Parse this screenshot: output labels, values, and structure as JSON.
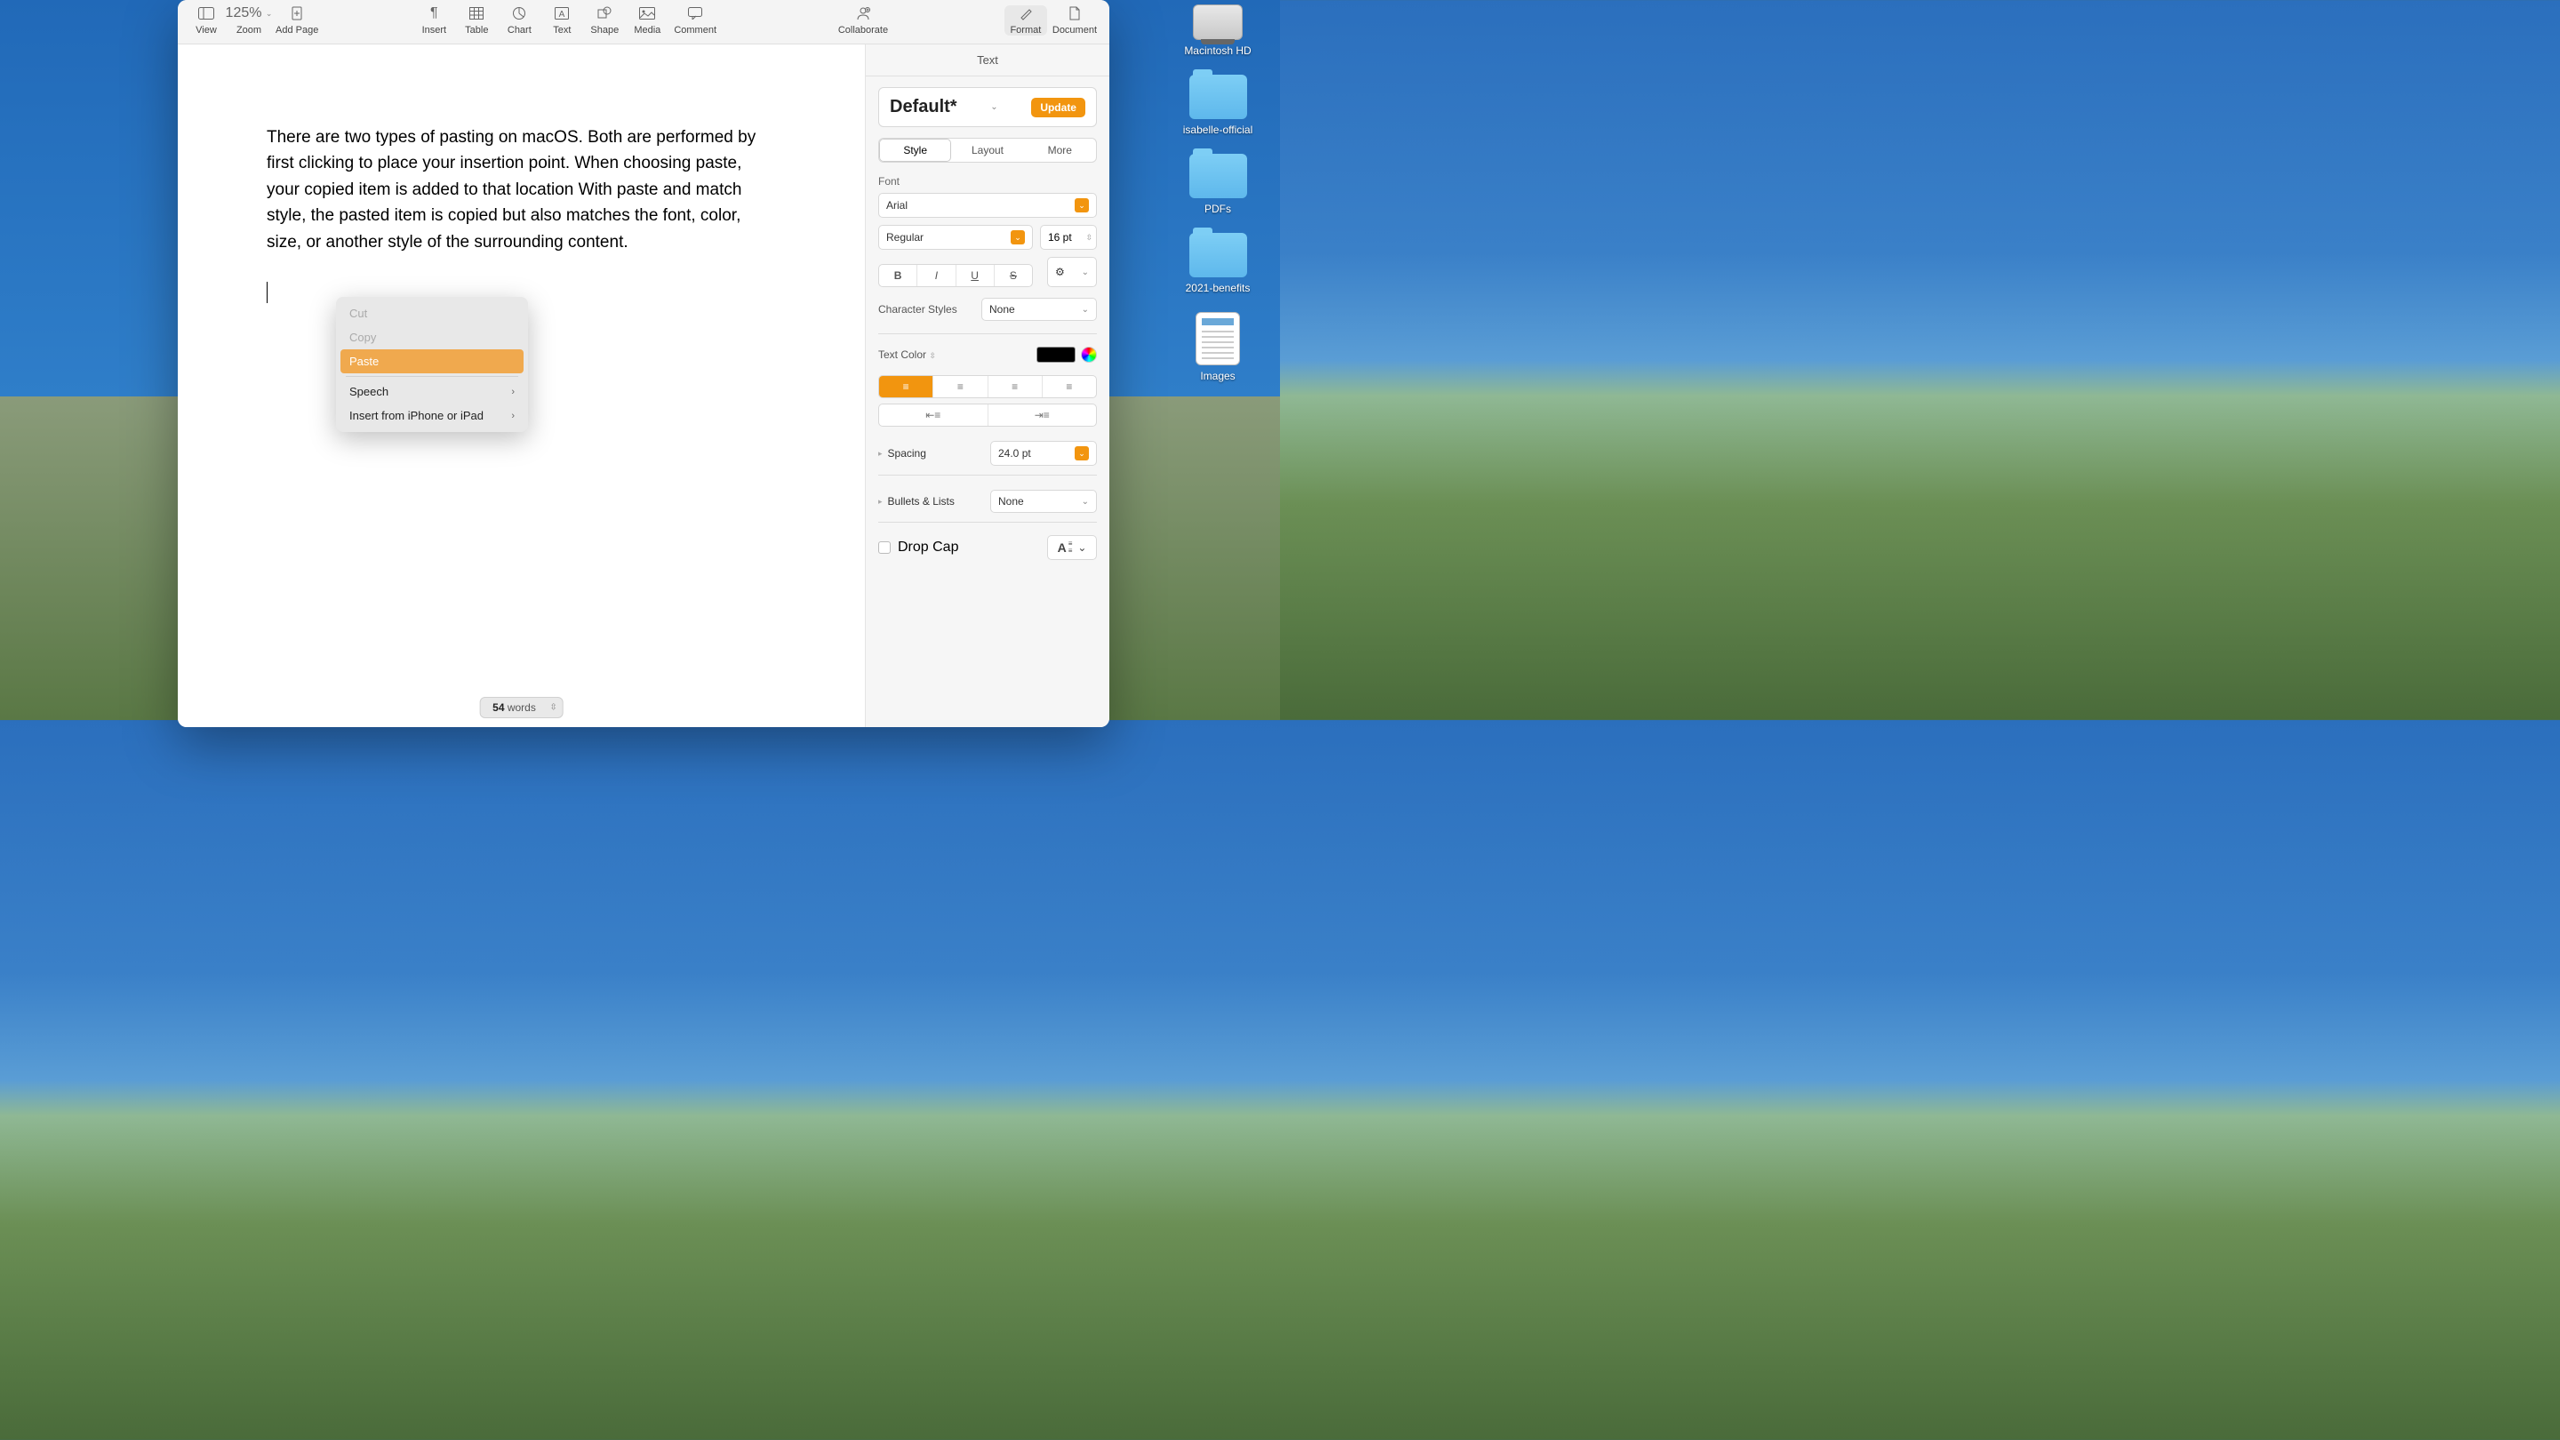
{
  "desktop": {
    "icons": [
      {
        "type": "hd",
        "label": "Macintosh HD"
      },
      {
        "type": "folder",
        "label": "isabelle-official"
      },
      {
        "type": "folder",
        "label": "PDFs"
      },
      {
        "type": "folder",
        "label": "2021-benefits"
      },
      {
        "type": "img",
        "label": "Images"
      }
    ]
  },
  "toolbar": {
    "view": "View",
    "zoom_label": "Zoom",
    "zoom_value": "125%",
    "add_page": "Add Page",
    "insert": "Insert",
    "table": "Table",
    "chart": "Chart",
    "text": "Text",
    "shape": "Shape",
    "media": "Media",
    "comment": "Comment",
    "collaborate": "Collaborate",
    "format": "Format",
    "document": "Document"
  },
  "document": {
    "body": "There are two types of pasting on macOS. Both are performed by first clicking to place your insertion point. When choosing paste, your copied item is added to that location With paste and match style, the pasted item is copied but also matches the font, color, size, or another style of the surrounding content.",
    "word_count_num": "54",
    "word_count_label": " words"
  },
  "context_menu": {
    "cut": "Cut",
    "copy": "Copy",
    "paste": "Paste",
    "speech": "Speech",
    "insert_device": "Insert from iPhone or iPad"
  },
  "inspector": {
    "tab": "Text",
    "style_name": "Default*",
    "update": "Update",
    "tabs": {
      "style": "Style",
      "layout": "Layout",
      "more": "More"
    },
    "font_label": "Font",
    "font_family": "Arial",
    "font_weight": "Regular",
    "font_size": "16 pt",
    "char_styles_label": "Character Styles",
    "char_styles_value": "None",
    "text_color_label": "Text Color",
    "spacing_label": "Spacing",
    "spacing_value": "24.0 pt",
    "bullets_label": "Bullets & Lists",
    "bullets_value": "None",
    "dropcap_label": "Drop Cap"
  }
}
